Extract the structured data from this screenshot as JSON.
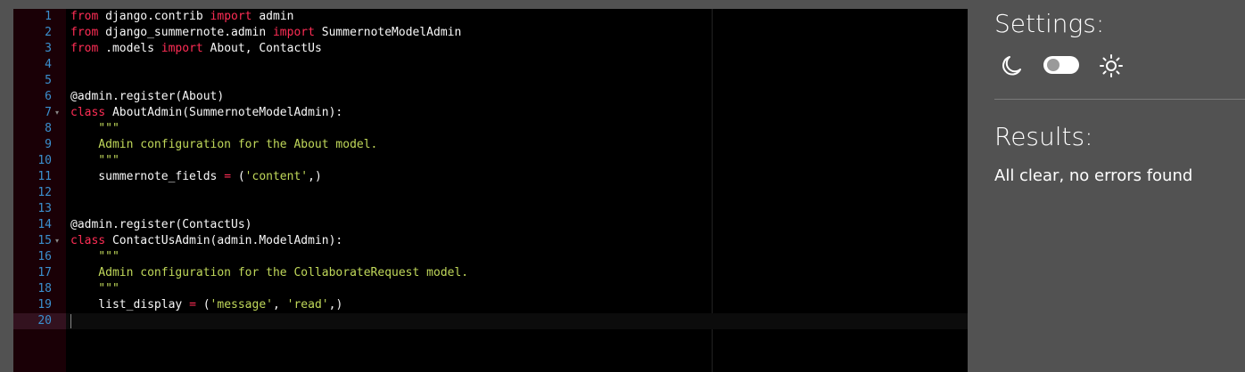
{
  "editor": {
    "lines": [
      {
        "n": "1",
        "tokens": [
          {
            "t": "from",
            "c": "kw"
          },
          {
            "t": " django.contrib ",
            "c": "plain"
          },
          {
            "t": "import",
            "c": "kw"
          },
          {
            "t": " admin",
            "c": "plain"
          }
        ]
      },
      {
        "n": "2",
        "tokens": [
          {
            "t": "from",
            "c": "kw"
          },
          {
            "t": " django_summernote.admin ",
            "c": "plain"
          },
          {
            "t": "import",
            "c": "kw"
          },
          {
            "t": " SummernoteModelAdmin",
            "c": "plain"
          }
        ]
      },
      {
        "n": "3",
        "tokens": [
          {
            "t": "from",
            "c": "kw"
          },
          {
            "t": " .models ",
            "c": "plain"
          },
          {
            "t": "import",
            "c": "kw"
          },
          {
            "t": " About, ContactUs",
            "c": "plain"
          }
        ]
      },
      {
        "n": "4",
        "tokens": []
      },
      {
        "n": "5",
        "tokens": []
      },
      {
        "n": "6",
        "tokens": [
          {
            "t": "@admin.register(About)",
            "c": "plain"
          }
        ]
      },
      {
        "n": "7",
        "fold": true,
        "tokens": [
          {
            "t": "class",
            "c": "kw"
          },
          {
            "t": " AboutAdmin(SummernoteModelAdmin):",
            "c": "plain"
          }
        ]
      },
      {
        "n": "8",
        "tokens": [
          {
            "t": "    \"\"\"",
            "c": "str"
          }
        ]
      },
      {
        "n": "9",
        "tokens": [
          {
            "t": "    Admin configuration for the About model.",
            "c": "str"
          }
        ]
      },
      {
        "n": "10",
        "tokens": [
          {
            "t": "    \"\"\"",
            "c": "str"
          }
        ]
      },
      {
        "n": "11",
        "tokens": [
          {
            "t": "    summernote_fields ",
            "c": "plain"
          },
          {
            "t": "=",
            "c": "op"
          },
          {
            "t": " (",
            "c": "plain"
          },
          {
            "t": "'content'",
            "c": "str"
          },
          {
            "t": ",)",
            "c": "plain"
          }
        ]
      },
      {
        "n": "12",
        "tokens": []
      },
      {
        "n": "13",
        "tokens": []
      },
      {
        "n": "14",
        "tokens": [
          {
            "t": "@admin.register(ContactUs)",
            "c": "plain"
          }
        ]
      },
      {
        "n": "15",
        "fold": true,
        "tokens": [
          {
            "t": "class",
            "c": "kw"
          },
          {
            "t": " ContactUsAdmin(admin.ModelAdmin):",
            "c": "plain"
          }
        ]
      },
      {
        "n": "16",
        "tokens": [
          {
            "t": "    \"\"\"",
            "c": "str"
          }
        ]
      },
      {
        "n": "17",
        "tokens": [
          {
            "t": "    Admin configuration for the CollaborateRequest model.",
            "c": "str"
          }
        ]
      },
      {
        "n": "18",
        "tokens": [
          {
            "t": "    \"\"\"",
            "c": "str"
          }
        ]
      },
      {
        "n": "19",
        "tokens": [
          {
            "t": "    list_display ",
            "c": "plain"
          },
          {
            "t": "=",
            "c": "op"
          },
          {
            "t": " (",
            "c": "plain"
          },
          {
            "t": "'message'",
            "c": "str"
          },
          {
            "t": ", ",
            "c": "plain"
          },
          {
            "t": "'read'",
            "c": "str"
          },
          {
            "t": ",)",
            "c": "plain"
          }
        ]
      },
      {
        "n": "20",
        "active": true,
        "tokens": []
      }
    ]
  },
  "settings": {
    "title": "Settings:",
    "dark_icon": "moon-icon",
    "light_icon": "sun-icon",
    "theme_toggle_on": false
  },
  "results": {
    "title": "Results:",
    "message": "All clear, no errors found"
  },
  "colors": {
    "keyword": "#ff2d55",
    "string": "#c0d85a",
    "line_number": "#3b8fcf",
    "panel_bg": "#525252",
    "editor_bg": "#000000"
  }
}
